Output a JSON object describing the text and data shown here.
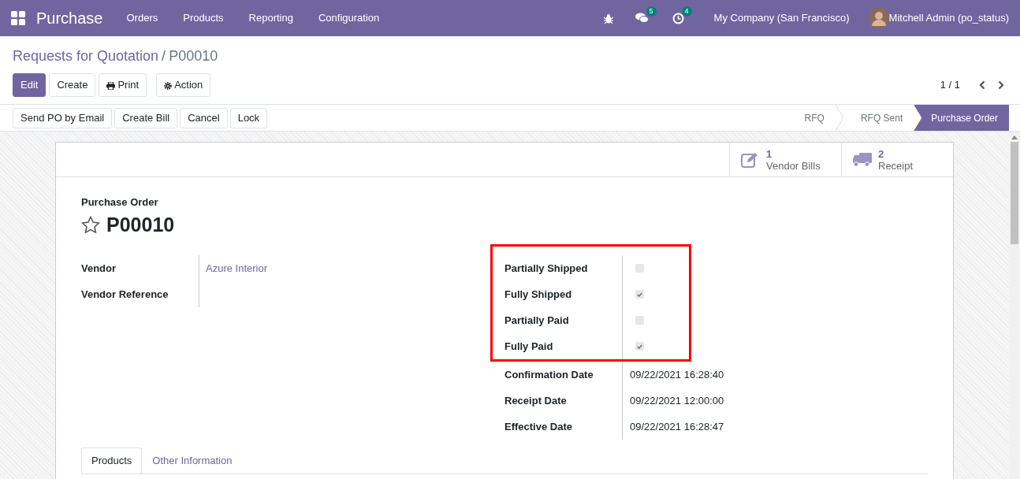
{
  "navbar": {
    "app_name": "Purchase",
    "menu": [
      "Orders",
      "Products",
      "Reporting",
      "Configuration"
    ],
    "messages_count": "5",
    "activities_count": "4",
    "company": "My Company (San Francisco)",
    "user": "Mitchell Admin (po_status)"
  },
  "breadcrumb": {
    "parent": "Requests for Quotation",
    "separator": "/",
    "current": "P00010"
  },
  "buttons": [
    {
      "label": "Edit",
      "kind": "primary"
    },
    {
      "label": "Create",
      "kind": "plain"
    },
    {
      "label": "Print",
      "kind": "print"
    },
    {
      "label": "Action",
      "kind": "action"
    }
  ],
  "pager": "1 / 1",
  "header_buttons": [
    "Send PO by Email",
    "Create Bill",
    "Cancel",
    "Lock"
  ],
  "stages": [
    {
      "label": "RFQ",
      "selected": false
    },
    {
      "label": "RFQ Sent",
      "selected": false
    },
    {
      "label": "Purchase Order",
      "selected": true
    }
  ],
  "smart_buttons": [
    {
      "kind": "bills",
      "count": "1",
      "label": "Vendor Bills"
    },
    {
      "kind": "receipt",
      "count": "2",
      "label": "Receipt"
    }
  ],
  "title_label": "Purchase Order",
  "starred": false,
  "title": "P00010",
  "left_fields": [
    {
      "label": "Vendor",
      "value": "Azure Interior",
      "kind": "link"
    },
    {
      "label": "Vendor Reference",
      "kind": "text"
    }
  ],
  "status_checks": {
    "highlighted": true,
    "items": [
      {
        "label": "Partially Shipped",
        "checked": false
      },
      {
        "label": "Fully Shipped",
        "checked": true
      },
      {
        "label": "Partially Paid",
        "checked": false
      },
      {
        "label": "Fully Paid",
        "checked": true
      }
    ]
  },
  "dates": [
    {
      "label": "Confirmation Date",
      "value": "09/22/2021 16:28:40"
    },
    {
      "label": "Receipt Date",
      "value": "09/22/2021 12:00:00"
    },
    {
      "label": "Effective Date",
      "value": "09/22/2021 16:28:47"
    }
  ],
  "tabs": [
    {
      "label": "Products",
      "selected": true
    },
    {
      "label": "Other Information",
      "selected": false
    }
  ]
}
